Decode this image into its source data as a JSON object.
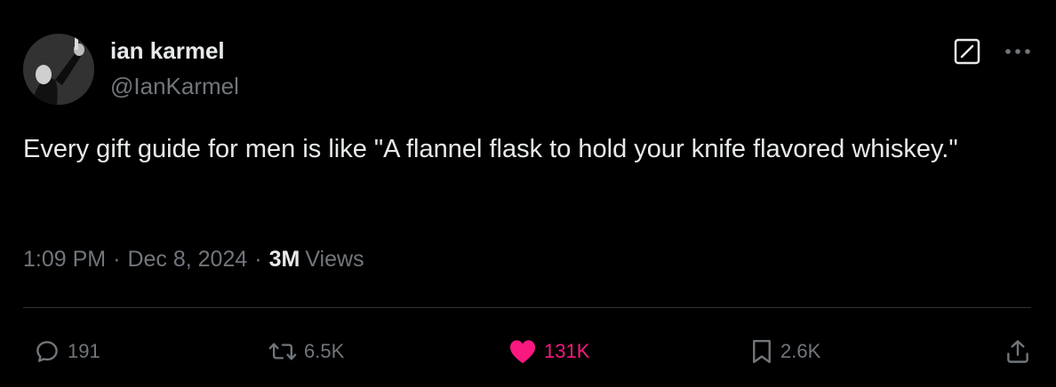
{
  "author": {
    "display_name": "ian karmel",
    "handle": "@IanKarmel"
  },
  "tweet": {
    "text": "Every gift guide for men is like \"A flannel flask to hold your knife flavored whiskey.\"",
    "time": "1:09 PM",
    "separator": "·",
    "date": "Dec 8, 2024",
    "views_count": "3M",
    "views_label": "Views"
  },
  "icons": {
    "edit": "edit-icon",
    "more": "more-icon",
    "reply": "reply-icon",
    "retweet": "retweet-icon",
    "like": "heart-icon",
    "bookmark": "bookmark-icon",
    "share": "share-icon"
  },
  "actions": {
    "replies": "191",
    "retweets": "6.5K",
    "likes": "131K",
    "bookmarks": "2.6K"
  },
  "colors": {
    "background": "#000000",
    "text": "#e7e9ea",
    "secondary": "#71767b",
    "like": "#f91880",
    "divider": "#2f3336"
  }
}
